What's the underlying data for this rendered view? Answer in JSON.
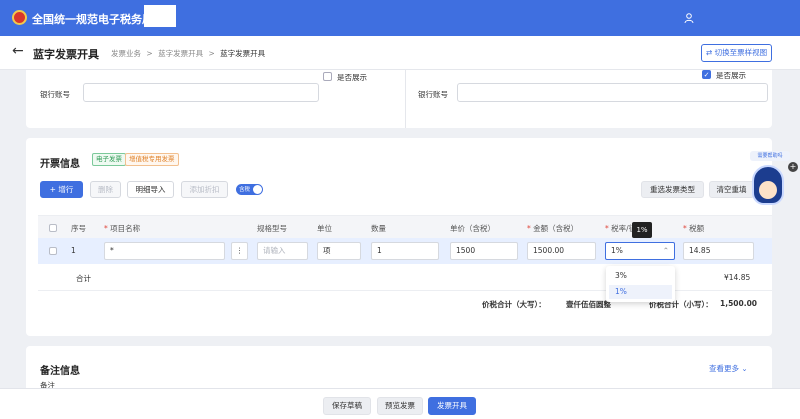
{
  "header": {
    "title": "全国统一规范电子税务局"
  },
  "subheader": {
    "page_title": "蓝字发票开具",
    "breadcrumb": [
      "发票业务",
      ">",
      "蓝字发票开具",
      ">",
      "蓝字发票开具"
    ],
    "switch_button": "切换至票样视图"
  },
  "buyer_seller": {
    "left": {
      "show_label": "是否展示",
      "show_checked": false,
      "bank_label": "银行账号",
      "bank_value": ""
    },
    "right": {
      "show_label": "是否展示",
      "show_checked": true,
      "bank_label": "银行账号",
      "bank_value": ""
    }
  },
  "invoice": {
    "section_title": "开票信息",
    "tags": [
      "电子发票",
      "增值税专用发票"
    ],
    "toolbar": {
      "add": "+ 增行",
      "delete": "删除",
      "detail_import": "明细导入",
      "add_discount": "添加折扣",
      "tax_included": "含税",
      "reselect_type": "重选发票类型",
      "clear_refill": "清空重填"
    },
    "columns": {
      "seq": "序号",
      "item_name": "项目名称",
      "spec": "规格型号",
      "unit": "单位",
      "qty": "数量",
      "unit_price": "单价（含税）",
      "amount": "金额（含税）",
      "tax_rate": "税率/征收率",
      "tax": "税额"
    },
    "row": {
      "seq": "1",
      "item_name": "*",
      "spec_placeholder": "请输入",
      "unit": "项",
      "qty": "1",
      "unit_price": "1500",
      "amount": "1500.00",
      "tax_rate": "1%",
      "tax": "14.85"
    },
    "tax_rate_options": [
      "3%",
      "1%"
    ],
    "tooltip": "1%",
    "subtotal_label": "合计",
    "subtotal_tax": "¥14.85",
    "total_upper_label": "价税合计（大写）：",
    "total_upper_value": "壹仟伍佰圆整",
    "total_lower_label": "价税合计（小写）：",
    "total_lower_value": "1,500.00"
  },
  "remarks": {
    "section_title": "备注信息",
    "see_more": "查看更多",
    "label": "备注"
  },
  "footer": {
    "save_draft": "保存草稿",
    "preview": "预览发票",
    "issue": "发票开具"
  },
  "assistant": {
    "bubble": "需要帮助吗"
  }
}
